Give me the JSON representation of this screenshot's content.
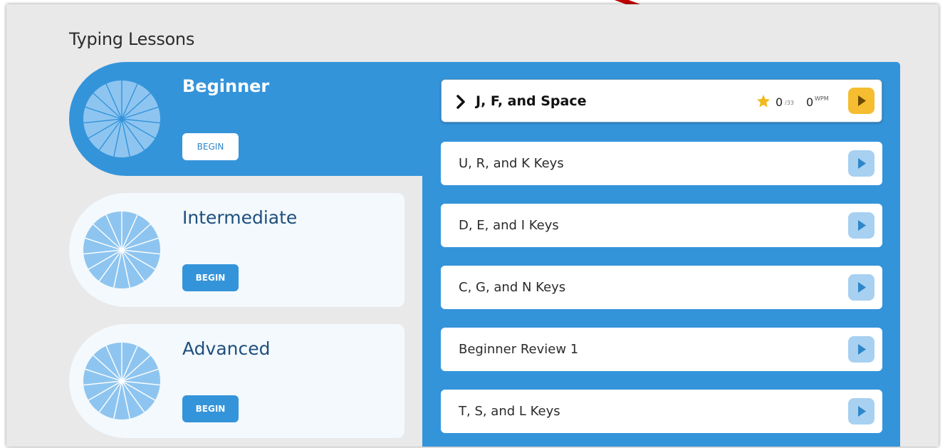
{
  "page": {
    "title": "Typing Lessons"
  },
  "levels": [
    {
      "name": "Beginner",
      "button_label": "BEGIN",
      "active": true
    },
    {
      "name": "Intermediate",
      "button_label": "BEGIN",
      "active": false
    },
    {
      "name": "Advanced",
      "button_label": "BEGIN",
      "active": false
    }
  ],
  "lessons": [
    {
      "title": "J, F, and Space",
      "current": true,
      "stars": "0",
      "stars_total": "/33",
      "wpm": "0",
      "wpm_unit": "WPM"
    },
    {
      "title": "U, R, and K Keys",
      "current": false
    },
    {
      "title": "D, E, and I Keys",
      "current": false
    },
    {
      "title": "C, G, and N Keys",
      "current": false
    },
    {
      "title": "Beginner Review 1",
      "current": false
    },
    {
      "title": "T, S, and L Keys",
      "current": false
    }
  ],
  "icons": {
    "level": "pie-wheel-icon",
    "star": "star-icon",
    "play": "play-icon",
    "expand": "chevron-right-icon",
    "annotation": "red-arrow"
  },
  "colors": {
    "primary_blue": "#3494da",
    "light_blue": "#a7d0f1",
    "wheel_fill": "#8ec5f0",
    "accent_yellow": "#f5bd2f",
    "star": "#f2b91f",
    "arrow_red": "#c00000",
    "card_bg": "#f3f9fc",
    "panel_bg": "#e9e9ea"
  }
}
